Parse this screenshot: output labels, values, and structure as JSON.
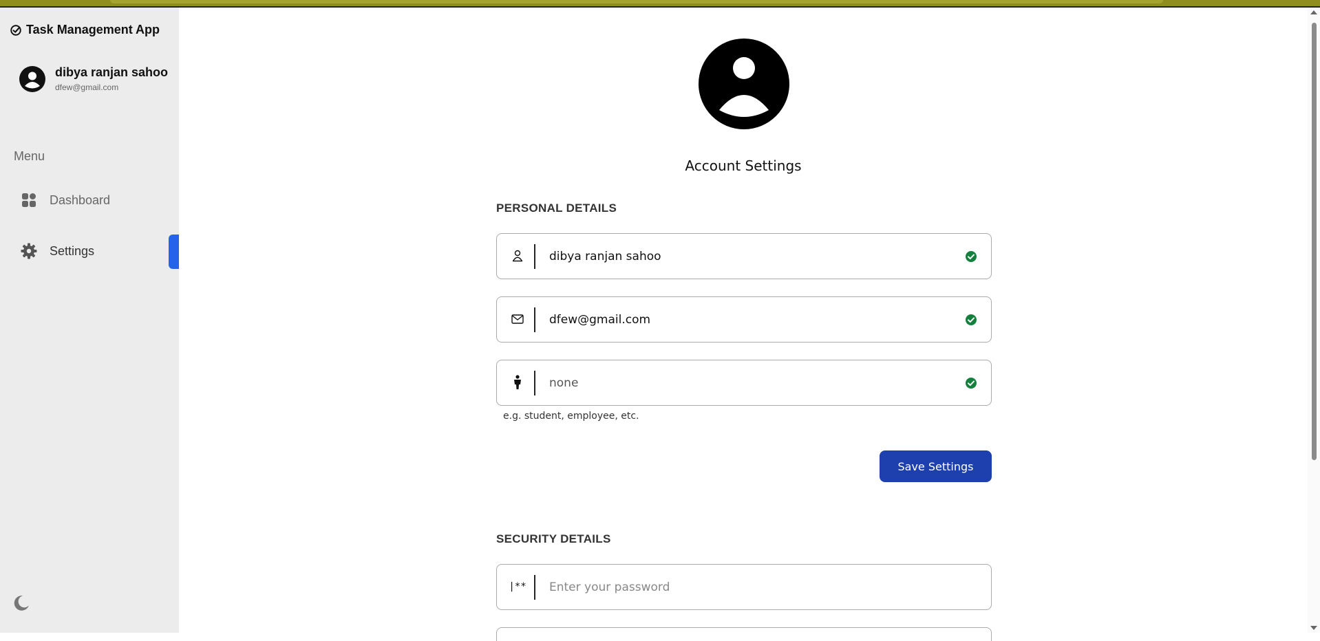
{
  "app": {
    "title": "Task Management App",
    "logo_icon": "check-circle-icon"
  },
  "user": {
    "name": "dibya ranjan sahoo",
    "email": "dfew@gmail.com"
  },
  "sidebar": {
    "menu_label": "Menu",
    "items": [
      {
        "label": "Dashboard",
        "icon": "dashboard-grid-icon",
        "active": false
      },
      {
        "label": "Settings",
        "icon": "gear-icon",
        "active": true
      }
    ],
    "theme_icon": "moon-icon"
  },
  "main": {
    "title": "Account Settings",
    "personal": {
      "heading": "PERSONAL DETAILS",
      "name_value": "dibya ranjan sahoo",
      "email_value": "dfew@gmail.com",
      "role_value": "none",
      "role_helper": "e.g. student, employee, etc.",
      "save_label": "Save Settings"
    },
    "security": {
      "heading": "SECURITY DETAILS",
      "password_icon_text": "|**",
      "password_placeholder": "Enter your password"
    }
  },
  "colors": {
    "accent": "#2563eb",
    "button": "#1e40af",
    "valid": "#15803d",
    "sidebar_bg": "#ececec"
  }
}
